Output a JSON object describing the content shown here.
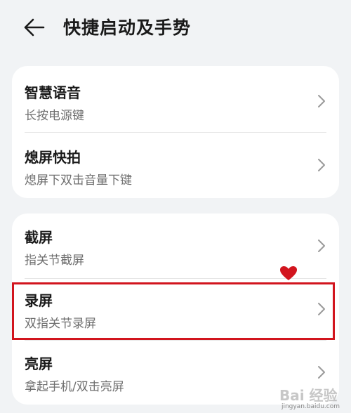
{
  "header": {
    "title": "快捷启动及手势",
    "back_icon": "arrow-left-icon"
  },
  "groups": [
    {
      "items": [
        {
          "title": "智慧语音",
          "subtitle": "长按电源键"
        },
        {
          "title": "熄屏快拍",
          "subtitle": "熄屏下双击音量下键"
        }
      ]
    },
    {
      "items": [
        {
          "title": "截屏",
          "subtitle": "指关节截屏"
        },
        {
          "title": "录屏",
          "subtitle": "双指关节录屏"
        },
        {
          "title": "亮屏",
          "subtitle": "拿起手机/双击亮屏"
        }
      ]
    }
  ],
  "watermark": {
    "logo": "Bai 经验",
    "url": "jingyan.baidu.com"
  },
  "colors": {
    "background": "#f1f3f5",
    "card": "#ffffff",
    "highlight": "#d2151e"
  }
}
